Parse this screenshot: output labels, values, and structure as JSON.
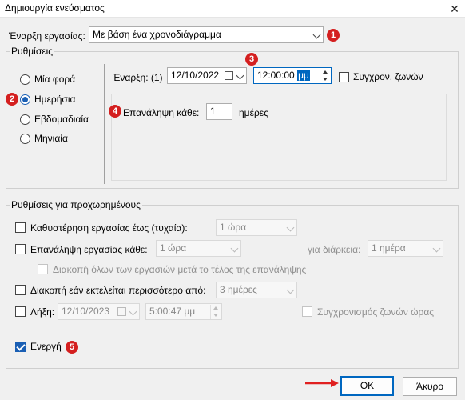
{
  "window": {
    "title": "Δημιουργία ενεύσματος",
    "close_glyph": "✕"
  },
  "start_task": {
    "label": "Έναρξη εργασίας:",
    "value": "Με βάση ένα χρονοδιάγραμμα"
  },
  "settings": {
    "legend": "Ρυθμίσεις",
    "frequency_options": [
      "Μία φορά",
      "Ημερήσια",
      "Εβδομαδιαία",
      "Μηνιαία"
    ],
    "selected_frequency_index": 1,
    "start_label": "Έναρξη: (1)",
    "start_date": "12/10/2022",
    "start_time": "12:00:00",
    "start_time_suffix": "μμ",
    "sync_label": "Συγχρον. ζωνών",
    "sync_checked": false,
    "repeat_label": "Επανάληψη κάθε:",
    "repeat_value": "1",
    "repeat_unit": "ημέρες"
  },
  "advanced": {
    "legend": "Ρυθμίσεις για προχωρημένους",
    "delay_label": "Καθυστέρηση εργασίας έως (τυχαία):",
    "delay_value": "1 ώρα",
    "repeat_task_label": "Επανάληψη εργασίας κάθε:",
    "repeat_task_value": "1 ώρα",
    "duration_label": "για διάρκεια:",
    "duration_value": "1 ημέρα",
    "stop_all_label": "Διακοπή όλων των εργασιών μετά το τέλος της επανάληψης",
    "stop_if_label": "Διακοπή εάν εκτελείται περισσότερο από:",
    "stop_if_value": "3 ημέρες",
    "expire_label": "Λήξη:",
    "expire_date": "12/10/2023",
    "expire_time": "5:00:47 μμ",
    "sync_zones_label": "Συγχρονισμός ζωνών ώρας",
    "enabled_label": "Ενεργή",
    "enabled_checked": true
  },
  "badges": [
    "1",
    "2",
    "3",
    "4",
    "5"
  ],
  "buttons": {
    "ok": "OK",
    "cancel": "Άκυρο"
  },
  "colors": {
    "accent": "#1a5fb4",
    "badge": "#d41f1f",
    "arrow": "#e02020",
    "ok_border": "#0067c0"
  }
}
